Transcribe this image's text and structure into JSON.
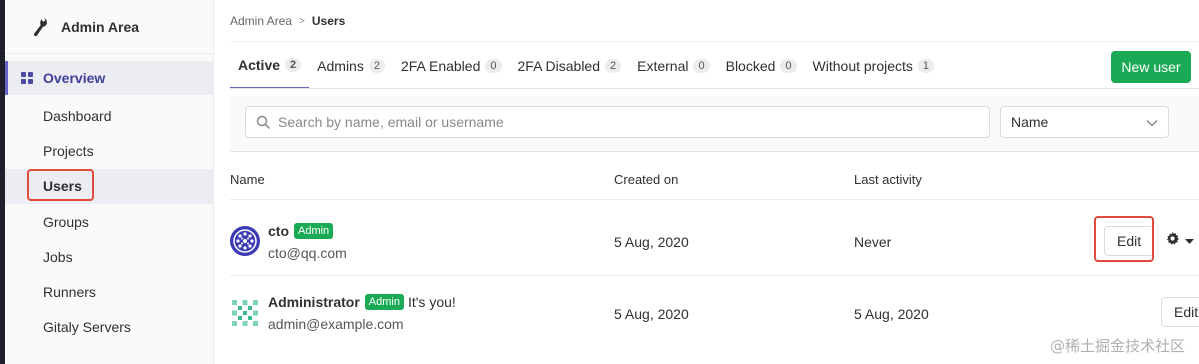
{
  "sidebar": {
    "title": "Admin Area",
    "overview_label": "Overview",
    "items": [
      {
        "label": "Dashboard"
      },
      {
        "label": "Projects"
      },
      {
        "label": "Users"
      },
      {
        "label": "Groups"
      },
      {
        "label": "Jobs"
      },
      {
        "label": "Runners"
      },
      {
        "label": "Gitaly Servers"
      }
    ]
  },
  "breadcrumb": {
    "parent": "Admin Area",
    "separator": ">",
    "current": "Users"
  },
  "tabs": [
    {
      "label": "Active",
      "count": "2"
    },
    {
      "label": "Admins",
      "count": "2"
    },
    {
      "label": "2FA Enabled",
      "count": "0"
    },
    {
      "label": "2FA Disabled",
      "count": "2"
    },
    {
      "label": "External",
      "count": "0"
    },
    {
      "label": "Blocked",
      "count": "0"
    },
    {
      "label": "Without projects",
      "count": "1"
    }
  ],
  "new_user_label": "New user",
  "search": {
    "placeholder": "Search by name, email or username",
    "value": ""
  },
  "sort": {
    "selected": "Name"
  },
  "table": {
    "headers": {
      "name": "Name",
      "created": "Created on",
      "last_activity": "Last activity"
    },
    "rows": [
      {
        "name": "cto",
        "badge": "Admin",
        "you": "",
        "email": "cto@qq.com",
        "created": "5 Aug, 2020",
        "last_activity": "Never",
        "edit_label": "Edit"
      },
      {
        "name": "Administrator",
        "badge": "Admin",
        "you": "It's you!",
        "email": "admin@example.com",
        "created": "5 Aug, 2020",
        "last_activity": "5 Aug, 2020",
        "edit_label": "Edit"
      }
    ]
  },
  "watermark": "@稀土掘金技术社区",
  "colors": {
    "accent": "#6666c4",
    "success": "#1aaa55",
    "highlight": "#e24a3b"
  }
}
